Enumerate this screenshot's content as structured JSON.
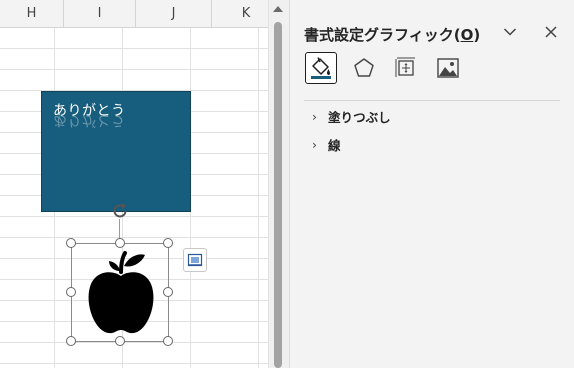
{
  "sheet": {
    "columns": [
      "H",
      "I",
      "J",
      "K"
    ],
    "text_shape": {
      "text": "ありがとう",
      "fill_color": "#175d7d"
    },
    "graphic": {
      "icon": "apple-icon",
      "fill_color": "#000000"
    }
  },
  "pane": {
    "title_main": "書式設定グラフィック",
    "title_shortcut_open": "(",
    "title_shortcut_key": "O",
    "title_shortcut_close": ")",
    "tabs": [
      {
        "name": "fill-and-line",
        "icon": "paint-bucket-icon",
        "selected": true
      },
      {
        "name": "effects",
        "icon": "pentagon-icon",
        "selected": false
      },
      {
        "name": "size-and-properties",
        "icon": "size-properties-icon",
        "selected": false
      },
      {
        "name": "picture",
        "icon": "picture-icon",
        "selected": false
      }
    ],
    "sections": [
      {
        "label": "塗りつぶし",
        "expanded": false
      },
      {
        "label": "線",
        "expanded": false
      }
    ],
    "chevron": "›",
    "accent": "#175d7d"
  }
}
